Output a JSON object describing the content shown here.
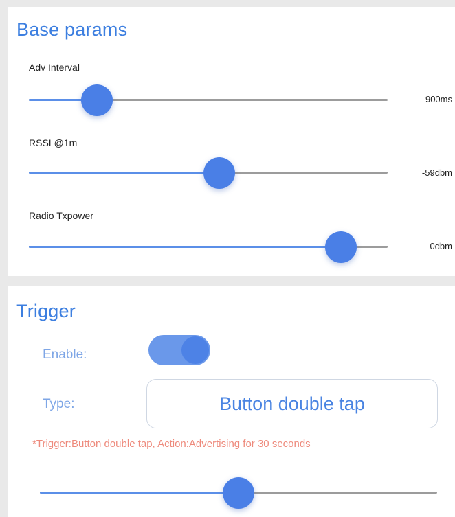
{
  "base_params": {
    "title": "Base params",
    "params": [
      {
        "label": "Adv Interval",
        "value": "900ms",
        "level": 0.19
      },
      {
        "label": "RSSI @1m",
        "value": "-59dbm",
        "level": 0.53
      },
      {
        "label": "Radio Txpower",
        "value": "0dbm",
        "level": 0.87
      }
    ]
  },
  "trigger": {
    "title": "Trigger",
    "enable_label": "Enable:",
    "enable_on": true,
    "type_label": "Type:",
    "type_value": "Button double tap",
    "hint": "*Trigger:Button double tap, Action:Advertising for 30 seconds",
    "slider_level": 0.5
  },
  "colors": {
    "accent": "#4a7fe6",
    "title": "#3d7fe0",
    "hint": "#ee8a7c",
    "track": "#9c9c9c"
  }
}
